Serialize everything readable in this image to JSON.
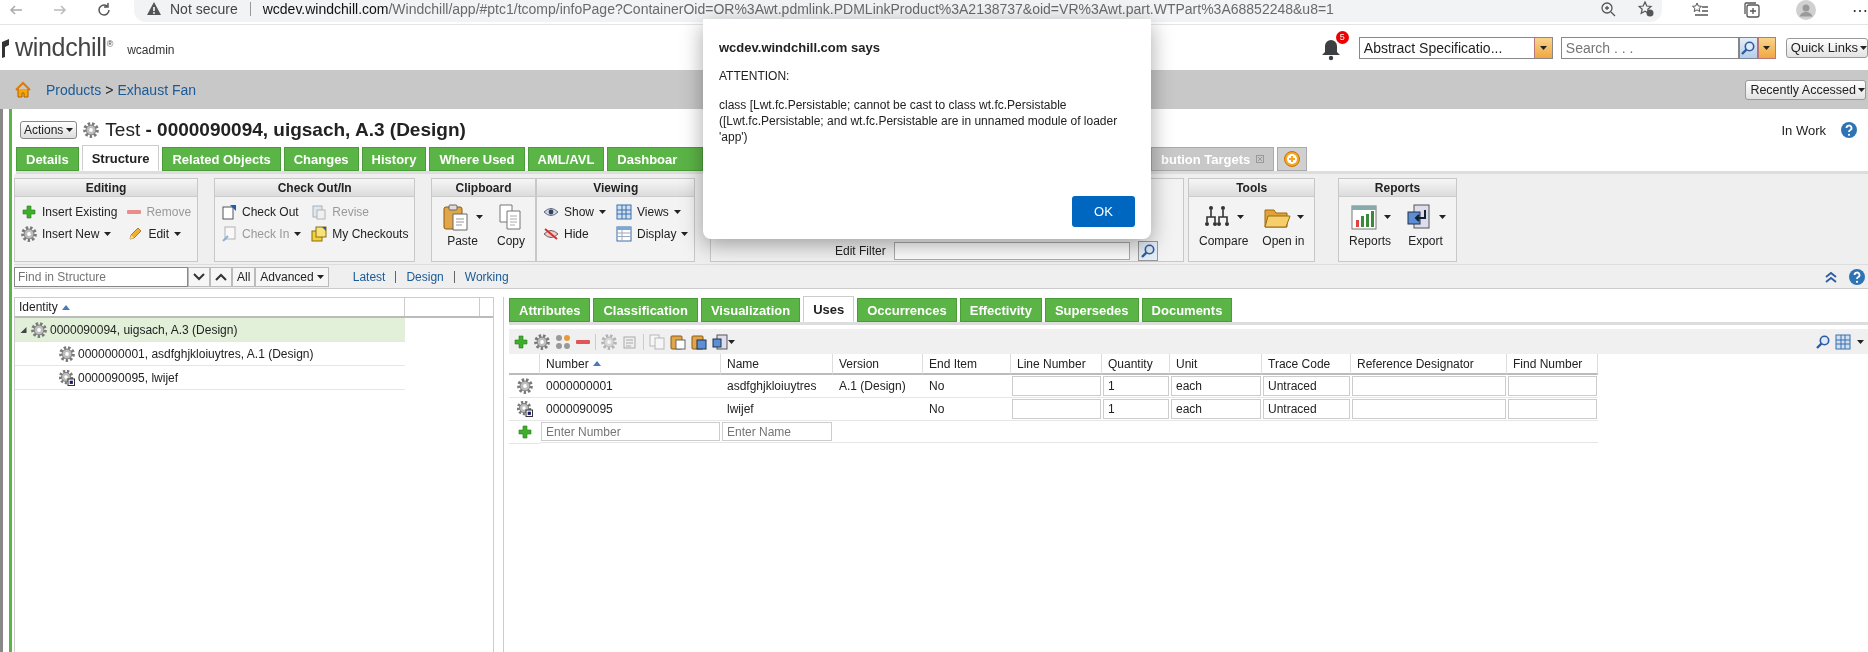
{
  "browser": {
    "security": "Not secure",
    "url_host": "wcdev.windchill.com",
    "url_path": "/Windchill/app/#ptc1/tcomp/infoPage?ContainerOid=OR%3Awt.pdmlink.PDMLinkProduct%3A2138737&oid=VR%3Awt.part.WTPart%3A68852248&u8=1",
    "menu": "⋯"
  },
  "header": {
    "logo": "windchill$^{®}$",
    "user": "wcadmin",
    "notification_count": "5",
    "type_select": "Abstract Specificatio...",
    "search": {
      "placeholder": "Search . . ."
    },
    "quick_links": "Quick Links"
  },
  "breadcrumb": {
    "items": [
      "Products",
      "Exhaust Fan"
    ],
    "separator": ">",
    "recently_accessed": "Recently Accessed"
  },
  "title": {
    "actions": "Actions",
    "text": "Test **- 0000090094, uigsach, A.3 (Design)**",
    "status": "In Work"
  },
  "tabs": [
    {
      "label": "Details",
      "selected": false
    },
    {
      "label": "Structure",
      "selected": true
    },
    {
      "label": "Related Objects",
      "selected": false
    },
    {
      "label": "Changes",
      "selected": false
    },
    {
      "label": "History",
      "selected": false
    },
    {
      "label": "Where Used",
      "selected": false
    },
    {
      "label": "AML/AVL",
      "selected": false
    },
    {
      "label": "Dashboar",
      "selected": false
    }
  ],
  "tabs_right": [
    {
      "label": "bution Targets",
      "selected": false
    }
  ],
  "toolbar_left": [
    {
      "title": "Editing",
      "kind": "small",
      "items": [
        {
          "label": "Insert Existing",
          "disabled": false,
          "dropdown": false
        },
        {
          "label": "Remove",
          "disabled": true,
          "dropdown": false
        },
        {
          "label": "Insert New",
          "disabled": false,
          "dropdown": true
        },
        {
          "label": "Edit",
          "disabled": false,
          "dropdown": true
        }
      ]
    },
    {
      "title": "Check Out/In",
      "kind": "small",
      "items": [
        {
          "label": "Check Out",
          "disabled": false,
          "dropdown": false
        },
        {
          "label": "Revise",
          "disabled": true,
          "dropdown": false
        },
        {
          "label": "Check In",
          "disabled": true,
          "dropdown": true
        },
        {
          "label": "My Checkouts",
          "disabled": false,
          "dropdown": false
        }
      ]
    },
    {
      "title": "Clipboard",
      "kind": "large",
      "items": [
        {
          "label": "Paste",
          "disabled": false,
          "dropdown": true
        },
        {
          "label": "Copy",
          "disabled": false,
          "dropdown": false
        }
      ]
    },
    {
      "title": "Viewing",
      "kind": "small",
      "items": [
        {
          "label": "Show",
          "disabled": false,
          "dropdown": true
        },
        {
          "label": "Views",
          "disabled": false,
          "dropdown": true
        },
        {
          "label": "Hide",
          "disabled": false,
          "dropdown": false
        },
        {
          "label": "Display",
          "disabled": false,
          "dropdown": true
        }
      ]
    }
  ],
  "edit_filter": {
    "label": "Edit Filter"
  },
  "toolbar_right": [
    {
      "title": "Tools",
      "kind": "large",
      "items": [
        {
          "label": "Compare",
          "disabled": false,
          "dropdown": true
        },
        {
          "label": "Open in",
          "disabled": false,
          "dropdown": true
        }
      ]
    },
    {
      "title": "Reports",
      "kind": "large",
      "items": [
        {
          "label": "Reports",
          "disabled": false,
          "dropdown": true
        },
        {
          "label": "Export",
          "disabled": false,
          "dropdown": true
        }
      ]
    }
  ],
  "find_bar": {
    "placeholder": "Find in Structure",
    "all": "All",
    "advanced": "Advanced",
    "filters": [
      "Latest",
      "Design",
      "Working"
    ]
  },
  "tree": {
    "column": "Identity",
    "nodes": [
      {
        "label": "0000090094, uigsach, A.3 (Design)",
        "kind": "part",
        "selected": true,
        "expanded": true,
        "children": [
          {
            "label": "0000000001, asdfghjkloiuytres, A.1 (Design)",
            "kind": "part",
            "selected": false
          },
          {
            "label": "0000090095, lwijef",
            "kind": "part-doc",
            "selected": false
          }
        ]
      }
    ]
  },
  "detail_tabs": [
    {
      "label": "Attributes",
      "selected": false
    },
    {
      "label": "Classification",
      "selected": false
    },
    {
      "label": "Visualization",
      "selected": false
    },
    {
      "label": "Uses",
      "selected": true
    },
    {
      "label": "Occurrences",
      "selected": false
    },
    {
      "label": "Effectivity",
      "selected": false
    },
    {
      "label": "Supersedes",
      "selected": false
    },
    {
      "label": "Documents",
      "selected": false
    }
  ],
  "uses_table": {
    "columns": [
      {
        "label": "Number",
        "sorted": true
      },
      {
        "label": "Name",
        "sorted": false
      },
      {
        "label": "Version",
        "sorted": false
      },
      {
        "label": "End Item",
        "sorted": false
      },
      {
        "label": "Line Number",
        "sorted": false
      },
      {
        "label": "Quantity",
        "sorted": false
      },
      {
        "label": "Unit",
        "sorted": false
      },
      {
        "label": "Trace Code",
        "sorted": false
      },
      {
        "label": "Reference Designator",
        "sorted": false
      },
      {
        "label": "Find Number",
        "sorted": false
      }
    ],
    "rows": [
      {
        "kind": "part",
        "number": "0000000001",
        "name": "asdfghjkloiuytres",
        "version": "A.1 (Design)",
        "end_item": "No",
        "quantity": "1",
        "unit": "each",
        "trace_code": "Untraced"
      },
      {
        "kind": "part-doc",
        "number": "0000090095",
        "name": "lwijef",
        "end_item": "No",
        "quantity": "1",
        "unit": "each",
        "trace_code": "Untraced"
      }
    ],
    "new_row": {
      "number_placeholder": "Enter Number",
      "name_placeholder": "Enter Name"
    }
  },
  "dialog": {
    "title": "wcdev.windchill.com says",
    "heading": "ATTENTION:",
    "message": "class [Lwt.fc.Persistable; cannot be cast to class wt.fc.Persistable ([Lwt.fc.Persistable; and wt.fc.Persistable are in unnamed module of loader 'app')",
    "button": "OK"
  }
}
